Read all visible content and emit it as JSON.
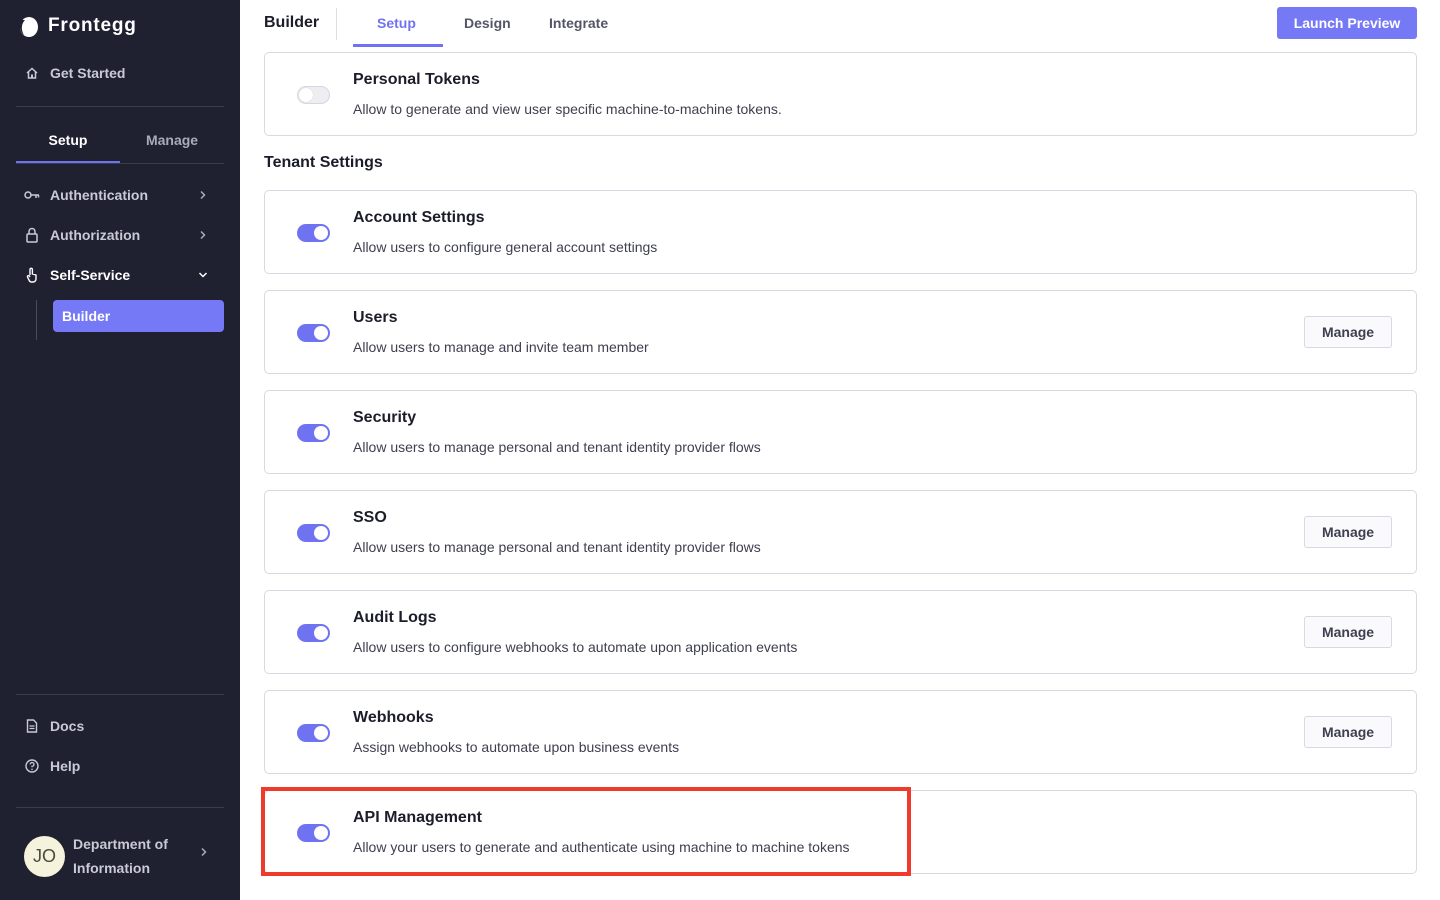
{
  "sidebar": {
    "brand": "Frontegg",
    "get_started": "Get Started",
    "tabs": [
      {
        "label": "Setup",
        "active": true
      },
      {
        "label": "Manage",
        "active": false
      }
    ],
    "nav": [
      {
        "label": "Authentication",
        "icon": "key-icon",
        "expanded": false
      },
      {
        "label": "Authorization",
        "icon": "lock-icon",
        "expanded": false
      },
      {
        "label": "Self-Service",
        "icon": "hand-pointer-icon",
        "expanded": true
      }
    ],
    "sub_item": "Builder",
    "bottom": [
      {
        "label": "Docs",
        "icon": "document-icon"
      },
      {
        "label": "Help",
        "icon": "help-circle-icon"
      }
    ],
    "account": {
      "initials": "JO",
      "name": "Department of Information"
    }
  },
  "header": {
    "title": "Builder",
    "tabs": [
      {
        "label": "Setup",
        "active": true
      },
      {
        "label": "Design",
        "active": false
      },
      {
        "label": "Integrate",
        "active": false
      }
    ],
    "launch_button": "Launch Preview"
  },
  "main": {
    "section_title": "Tenant Settings",
    "manage_label": "Manage",
    "top_card": {
      "title": "Personal Tokens",
      "description": "Allow to generate and view user specific machine-to-machine tokens.",
      "enabled": false
    },
    "cards": [
      {
        "title": "Account Settings",
        "description": "Allow users to configure general account settings",
        "enabled": true,
        "has_manage": false
      },
      {
        "title": "Users",
        "description": "Allow users to manage and invite team member",
        "enabled": true,
        "has_manage": true
      },
      {
        "title": "Security",
        "description": "Allow users to manage personal and tenant identity provider flows",
        "enabled": true,
        "has_manage": false
      },
      {
        "title": "SSO",
        "description": "Allow users to manage personal and tenant identity provider flows",
        "enabled": true,
        "has_manage": true
      },
      {
        "title": "Audit Logs",
        "description": "Allow users to configure webhooks to automate upon application events",
        "enabled": true,
        "has_manage": true
      },
      {
        "title": "Webhooks",
        "description": "Assign webhooks to automate upon business events",
        "enabled": true,
        "has_manage": true
      },
      {
        "title": "API Management",
        "description": "Allow your users to generate and authenticate using machine to machine tokens",
        "enabled": true,
        "has_manage": false,
        "highlighted": true
      }
    ]
  },
  "colors": {
    "sidebar_bg": "#1f2030",
    "accent": "#7579f5",
    "highlight_border": "#ef3b2c"
  }
}
